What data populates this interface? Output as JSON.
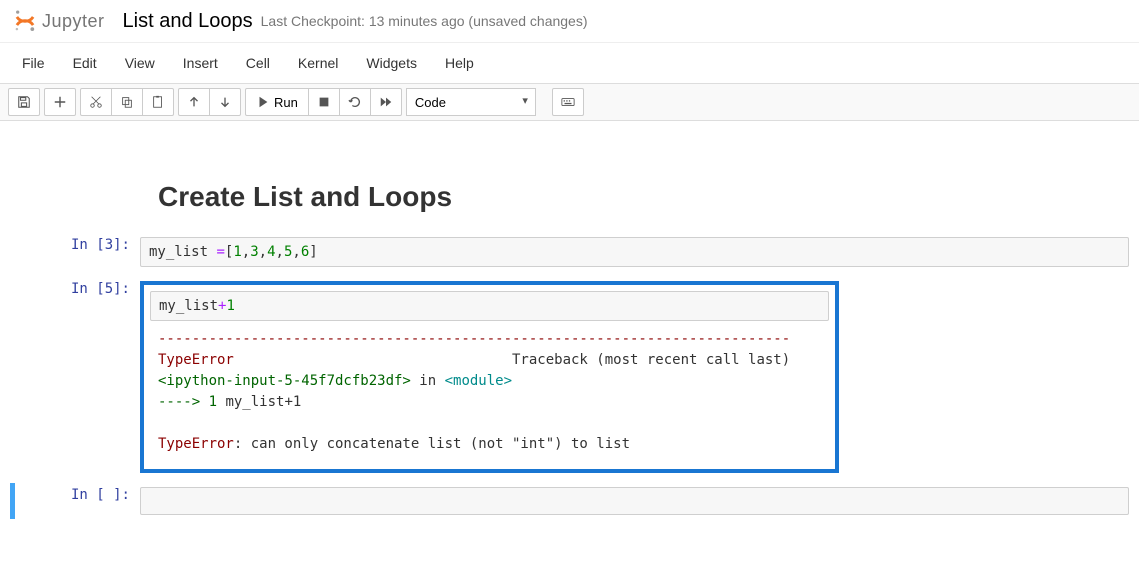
{
  "header": {
    "logo_text": "Jupyter",
    "title": "List and Loops",
    "checkpoint": "Last Checkpoint: 13 minutes ago  (unsaved changes)"
  },
  "menubar": [
    "File",
    "Edit",
    "View",
    "Insert",
    "Cell",
    "Kernel",
    "Widgets",
    "Help"
  ],
  "toolbar": {
    "run_label": "Run",
    "celltype": "Code"
  },
  "heading": "Create List and Loops",
  "cells": [
    {
      "prompt": "In [3]:",
      "code": "my_list =[1,3,4,5,6]"
    },
    {
      "prompt": "In [5]:",
      "code": "my_list+1",
      "error": {
        "sep": "---------------------------------------------------------------------------",
        "type": "TypeError",
        "traceback_header": "                                 Traceback (most recent call last)",
        "frame_pre": "<ipython-input-5-45f7dcfb23df>",
        "frame_mid": " in ",
        "frame_mod": "<module>",
        "arrow": "----> ",
        "lineno": "1",
        "frame_code": " my_list+1",
        "final_type": "TypeError",
        "final_msg": ": can only concatenate list (not \"int\") to list"
      }
    },
    {
      "prompt": "In [ ]:",
      "code": ""
    }
  ]
}
